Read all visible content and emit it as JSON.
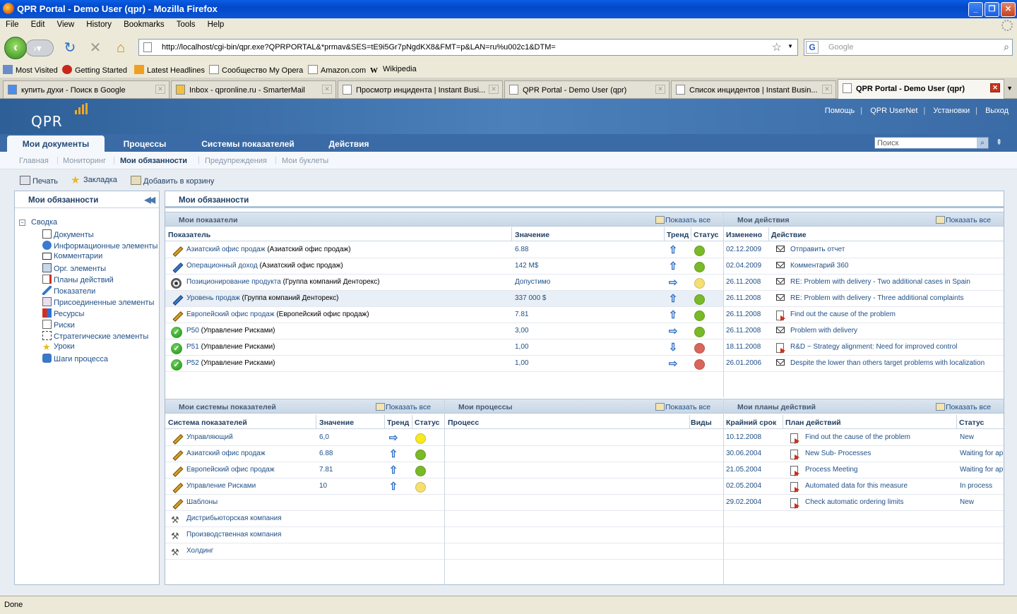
{
  "window": {
    "title": "QPR Portal - Demo User (qpr) - Mozilla Firefox"
  },
  "menubar": [
    "File",
    "Edit",
    "View",
    "History",
    "Bookmarks",
    "Tools",
    "Help"
  ],
  "url": "http://localhost/cgi-bin/qpr.exe?QPRPORTAL&*prmav&SES=tE9i5Gr7pNgdKX8&FMT=p&LAN=ru%u002c1&DTM=",
  "search_placeholder": "Google",
  "bookmarks": [
    "Most Visited",
    "Getting Started",
    "Latest Headlines",
    "Сообщество My Opera",
    "Amazon.com",
    "Wikipedia"
  ],
  "tabs": [
    "купить духи - Поиск в Google",
    "Inbox - qpronline.ru - SmarterMail",
    "Просмотр инцидента | Instant Busi...",
    "QPR Portal - Demo User (qpr)",
    "Список инцидентов | Instant Busin...",
    "QPR Portal - Demo User (qpr)"
  ],
  "portal": {
    "logo": "QPR",
    "toplinks": [
      "Помощь",
      "QPR UserNet",
      "Установки",
      "Выход"
    ],
    "mainnav": [
      "Мои документы",
      "Процессы",
      "Системы показателей",
      "Действия"
    ],
    "search_placeholder": "Поиск",
    "subnav": [
      "Главная",
      "Мониторинг",
      "Мои обязанности",
      "Предупреждения",
      "Мои буклеты"
    ],
    "toolbar": [
      "Печать",
      "Закладка",
      "Добавить в корзину"
    ],
    "left": {
      "title": "Мои обязанности",
      "root": "Сводка",
      "items": [
        "Документы",
        "Информационные элементы",
        "Комментарии",
        "Орг. элементы",
        "Планы действий",
        "Показатели",
        "Присоединенные элементы",
        "Ресурсы",
        "Риски",
        "Стратегические элементы",
        "Уроки",
        "Шаги процесса"
      ]
    },
    "main_title": "Мои обязанности",
    "show_all": "Показать все",
    "indicators": {
      "title": "Мои показатели",
      "cols": [
        "Показатель",
        "Значение",
        "Тренд",
        "Статус"
      ],
      "rows": [
        {
          "name": "Азиатский офис продаж",
          "ctx": "(Азиатский офис продаж)",
          "value": "6.88"
        },
        {
          "name": "Операционный доход",
          "ctx": "(Азиатский офис продаж)",
          "value": "142 M$"
        },
        {
          "name": "Позиционирование продукта",
          "ctx": "(Группа компаний Денторекс)",
          "value": "Допустимо"
        },
        {
          "name": "Уровень продаж",
          "ctx": "(Группа компаний Денторекс)",
          "value": "337 000 $"
        },
        {
          "name": "Европейский офис продаж",
          "ctx": "(Европейский офис продаж)",
          "value": "7.81"
        },
        {
          "name": "P50",
          "ctx": "(Управление Рисками)",
          "value": "3,00"
        },
        {
          "name": "P51",
          "ctx": "(Управление Рисками)",
          "value": "1,00"
        },
        {
          "name": "P52",
          "ctx": "(Управление Рисками)",
          "value": "1,00"
        }
      ]
    },
    "actions": {
      "title": "Мои действия",
      "cols": [
        "Изменено",
        "Действие"
      ],
      "rows": [
        {
          "date": "02.12.2009",
          "text": "Отправить отчет"
        },
        {
          "date": "02.04.2009",
          "text": "Комментарий 360"
        },
        {
          "date": "26.11.2008",
          "text": "RE: Problem with delivery - Two additional cases in Spain"
        },
        {
          "date": "26.11.2008",
          "text": "RE: Problem with delivery - Three additional complaints"
        },
        {
          "date": "26.11.2008",
          "text": "Find out the cause of the problem"
        },
        {
          "date": "26.11.2008",
          "text": "Problem with delivery"
        },
        {
          "date": "18.11.2008",
          "text": "R&D ~ Strategy alignment: Need for improved control"
        },
        {
          "date": "26.01.2006",
          "text": "Despite the lower than others target problems with localization"
        }
      ]
    },
    "scorecards": {
      "title": "Мои системы показателей",
      "cols": [
        "Система показателей",
        "Значение",
        "Тренд",
        "Статус"
      ],
      "rows": [
        {
          "name": "Управляющий",
          "value": "6,0"
        },
        {
          "name": "Азиатский офис продаж",
          "value": "6.88"
        },
        {
          "name": "Европейский офис продаж",
          "value": "7.81"
        },
        {
          "name": "Управление Рисками",
          "value": "10"
        },
        {
          "name": "Шаблоны",
          "value": ""
        },
        {
          "name": "Дистрибьюторская компания",
          "value": ""
        },
        {
          "name": "Производственная компания",
          "value": ""
        },
        {
          "name": "Холдинг",
          "value": ""
        }
      ]
    },
    "processes": {
      "title": "Мои процессы",
      "cols": [
        "Процесс",
        "Виды"
      ]
    },
    "plans": {
      "title": "Мои планы действий",
      "cols": [
        "Крайний срок",
        "План действий",
        "Статус"
      ],
      "rows": [
        {
          "date": "10.12.2008",
          "text": "Find out the cause of the problem",
          "status": "New"
        },
        {
          "date": "30.06.2004",
          "text": "New Sub- Processes",
          "status": "Waiting for ap"
        },
        {
          "date": "21.05.2004",
          "text": "Process Meeting",
          "status": "Waiting for ap"
        },
        {
          "date": "02.05.2004",
          "text": "Automated data for this measure",
          "status": "In process"
        },
        {
          "date": "29.02.2004",
          "text": "Check automatic ordering limits",
          "status": "New"
        }
      ]
    }
  },
  "status": "Done",
  "colors": {
    "green": "#7ab927",
    "yellow": "#f7e825",
    "light_yellow": "#f5df70",
    "red": "#d9665a",
    "header_blue": "#3a6ba6"
  }
}
